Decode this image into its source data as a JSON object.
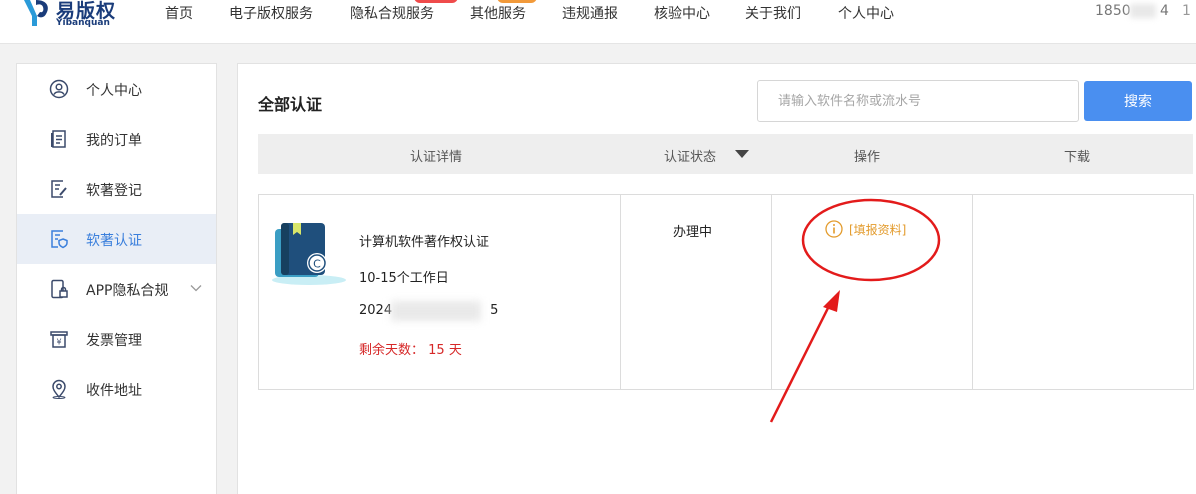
{
  "header": {
    "logo_text": "易版权",
    "logo_sub": "Yibanquan",
    "nav": [
      "首页",
      "电子版权服务",
      "隐私合规服务",
      "其他服务",
      "违规通报",
      "核验中心",
      "关于我们",
      "个人中心"
    ],
    "phone_prefix": "1850",
    "phone_suffix": "4",
    "phone_cut": "1"
  },
  "sidebar": {
    "items": [
      {
        "label": "个人中心",
        "icon": "user-icon"
      },
      {
        "label": "我的订单",
        "icon": "order-icon"
      },
      {
        "label": "软著登记",
        "icon": "register-icon"
      },
      {
        "label": "软著认证",
        "icon": "certify-icon"
      },
      {
        "label": "APP隐私合规",
        "icon": "app-lock-icon"
      },
      {
        "label": "发票管理",
        "icon": "invoice-icon"
      },
      {
        "label": "收件地址",
        "icon": "location-icon"
      }
    ],
    "active_index": 3
  },
  "main": {
    "title": "全部认证",
    "search": {
      "placeholder": "请输入软件名称或流水号",
      "button": "搜索"
    },
    "columns": [
      "认证详情",
      "认证状态",
      "操作",
      "下载"
    ],
    "rows": [
      {
        "name": "计算机软件著作权认证",
        "days": "10-15个工作日",
        "date_prefix": "2024",
        "date_suffix": "5",
        "remain_label": "剩余天数：",
        "remain_value": "15 天",
        "status": "办理中",
        "action": "[填报资料]"
      }
    ]
  },
  "colors": {
    "accent": "#4a8ff0",
    "active_text": "#3a7fdc",
    "active_bg": "#e9eef6",
    "warning": "#e39b2c",
    "danger": "#d62828",
    "annotation": "#e31b1b"
  }
}
